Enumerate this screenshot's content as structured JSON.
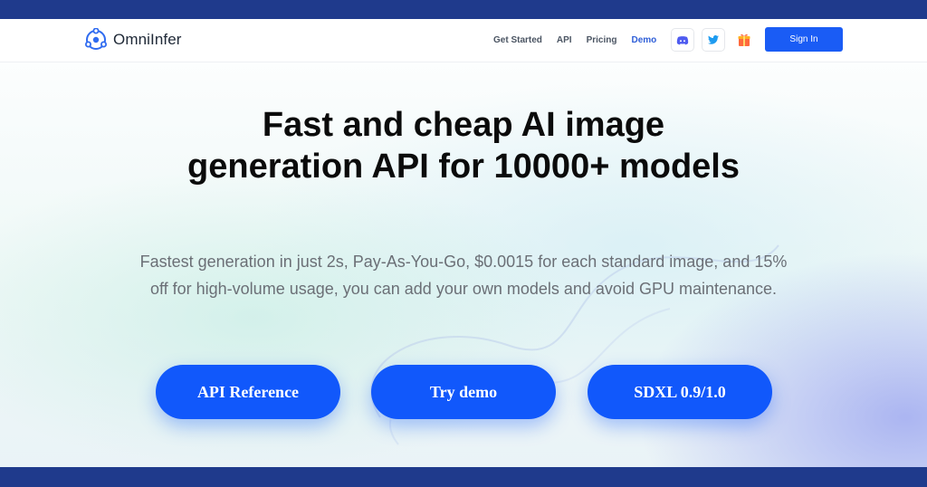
{
  "brand": {
    "name": "OmniInfer",
    "logo_icon": "omniinfer-logo-icon",
    "accent": "#1a5cf5"
  },
  "nav": {
    "links": [
      {
        "label": "Get Started"
      },
      {
        "label": "API"
      },
      {
        "label": "Pricing"
      },
      {
        "label": "Demo",
        "active": true
      }
    ],
    "icons": [
      "discord-icon",
      "twitter-icon",
      "gift-icon"
    ],
    "signin_label": "Sign In"
  },
  "hero": {
    "title_line1": "Fast and cheap AI image",
    "title_line2": "generation API for 10000+ models",
    "subtitle_line1": "Fastest generation in just 2s, Pay-As-You-Go, $0.0015 for each standard image, and 15%",
    "subtitle_line2": "off for high-volume usage, you can add your own models and avoid GPU maintenance."
  },
  "cta": [
    {
      "label": "API Reference"
    },
    {
      "label": "Try demo"
    },
    {
      "label": "SDXL 0.9/1.0"
    }
  ],
  "colors": {
    "frame": "#1f3a8c",
    "button": "#1158fb",
    "active_nav": "#2f5fd8"
  }
}
